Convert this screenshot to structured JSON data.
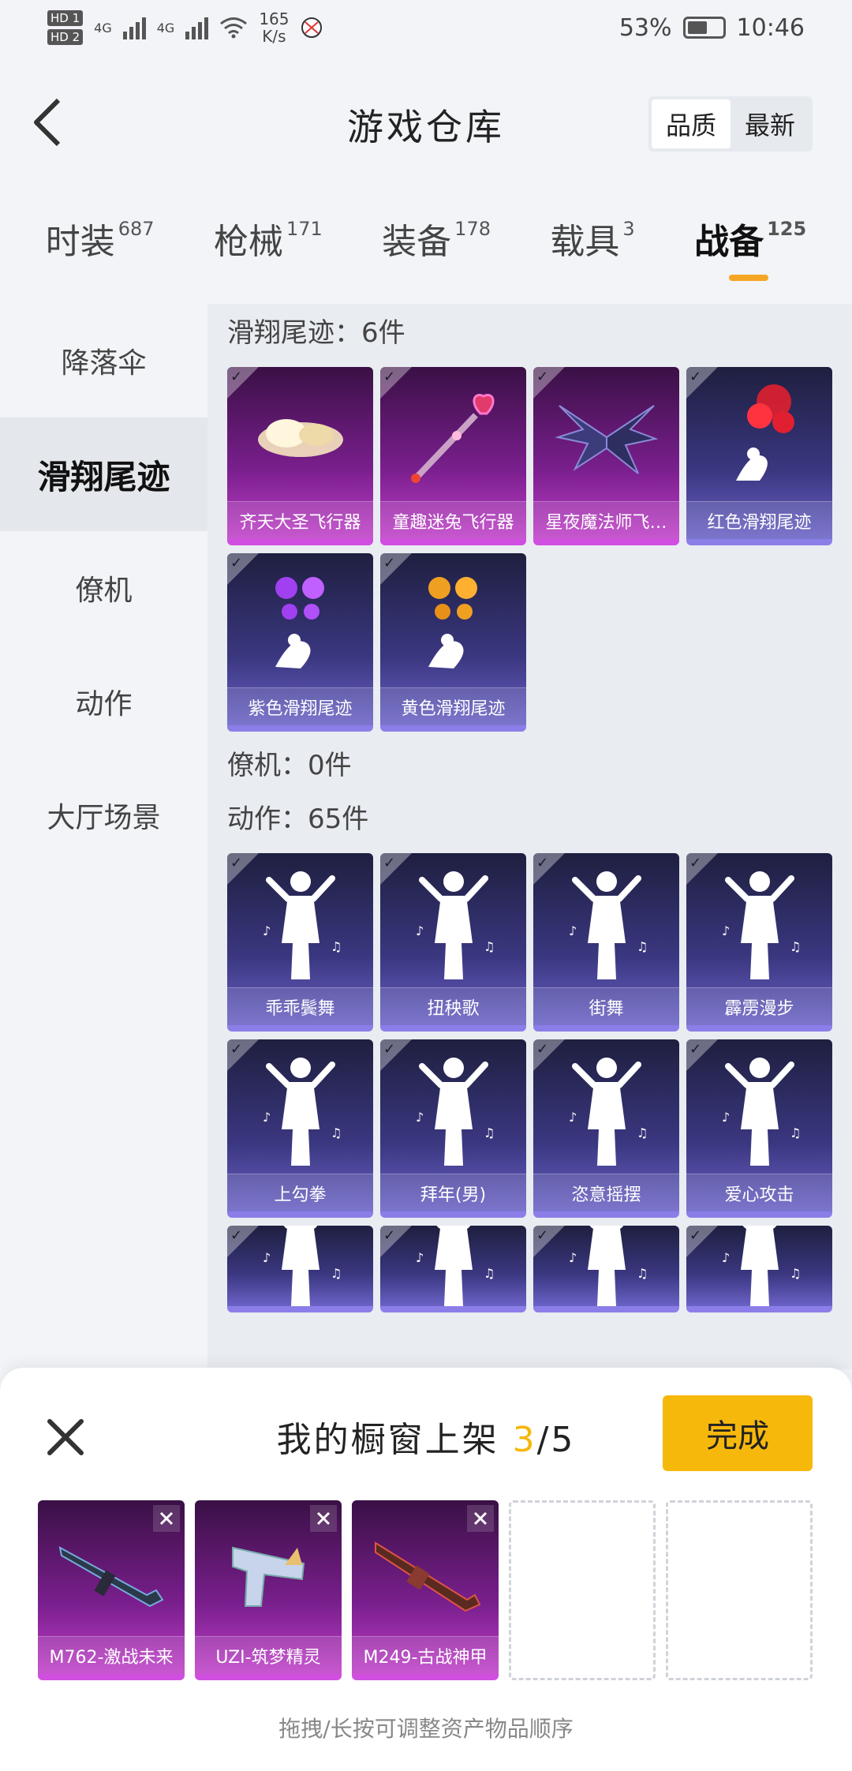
{
  "status_bar": {
    "hd1": "HD 1",
    "hd2": "HD 2",
    "net1": "4G",
    "net2": "4G",
    "speed_value": "165",
    "speed_unit": "K/s",
    "battery": "53%",
    "time": "10:46"
  },
  "header": {
    "title": "游戏仓库",
    "sort_options": [
      "品质",
      "最新"
    ],
    "sort_selected": "品质"
  },
  "categories": [
    {
      "label": "时装",
      "count": "687"
    },
    {
      "label": "枪械",
      "count": "171"
    },
    {
      "label": "装备",
      "count": "178"
    },
    {
      "label": "载具",
      "count": "3"
    },
    {
      "label": "战备",
      "count": "125",
      "active": true
    }
  ],
  "sidebar": {
    "items": [
      "降落伞",
      "滑翔尾迹",
      "僚机",
      "动作",
      "大厅场景"
    ],
    "selected": "滑翔尾迹"
  },
  "sections": [
    {
      "title": "滑翔尾迹：6件",
      "items": [
        {
          "label": "齐天大圣飞行器",
          "rarity": "pink",
          "icon": "cloud-icon"
        },
        {
          "label": "童趣迷兔飞行器",
          "rarity": "pink",
          "icon": "wand-icon"
        },
        {
          "label": "星夜魔法师飞…",
          "rarity": "pink",
          "icon": "wings-icon"
        },
        {
          "label": "红色滑翔尾迹",
          "rarity": "blue",
          "icon": "smoke-red-icon"
        },
        {
          "label": "紫色滑翔尾迹",
          "rarity": "blue",
          "icon": "smoke-purple-icon"
        },
        {
          "label": "黄色滑翔尾迹",
          "rarity": "blue",
          "icon": "smoke-yellow-icon"
        }
      ]
    },
    {
      "title": "僚机：0件",
      "items": []
    },
    {
      "title": "动作：65件",
      "items": [
        {
          "label": "乖乖鬓舞",
          "rarity": "blue",
          "icon": "dance-icon"
        },
        {
          "label": "扭秧歌",
          "rarity": "blue",
          "icon": "dance-icon"
        },
        {
          "label": "街舞",
          "rarity": "blue",
          "icon": "dance-icon"
        },
        {
          "label": "霹雳漫步",
          "rarity": "blue",
          "icon": "dance-icon"
        },
        {
          "label": "上勾拳",
          "rarity": "blue",
          "icon": "dance-icon"
        },
        {
          "label": "拜年(男)",
          "rarity": "blue",
          "icon": "dance-icon"
        },
        {
          "label": "恣意摇摆",
          "rarity": "blue",
          "icon": "dance-icon"
        },
        {
          "label": "爱心攻击",
          "rarity": "blue",
          "icon": "dance-icon"
        },
        {
          "label": "",
          "rarity": "blue",
          "icon": "dance-icon"
        },
        {
          "label": "",
          "rarity": "blue",
          "icon": "dance-icon"
        },
        {
          "label": "",
          "rarity": "blue",
          "icon": "dance-icon"
        },
        {
          "label": "",
          "rarity": "blue",
          "icon": "dance-icon"
        }
      ]
    }
  ],
  "showcase": {
    "title_prefix": "我的橱窗上架",
    "count": "3",
    "total": "/5",
    "done_label": "完成",
    "slots": [
      {
        "label": "M762-激战未来",
        "icon": "rifle-icon"
      },
      {
        "label": "UZI-筑梦精灵",
        "icon": "smg-icon"
      },
      {
        "label": "M249-古战神甲",
        "icon": "lmg-icon"
      },
      {
        "label": null
      },
      {
        "label": null
      }
    ],
    "hint": "拖拽/长按可调整资产物品顺序"
  },
  "colors": {
    "accent": "#f7b80c",
    "rarity_pink": "#c040c8",
    "rarity_blue": "#6a62c6"
  }
}
